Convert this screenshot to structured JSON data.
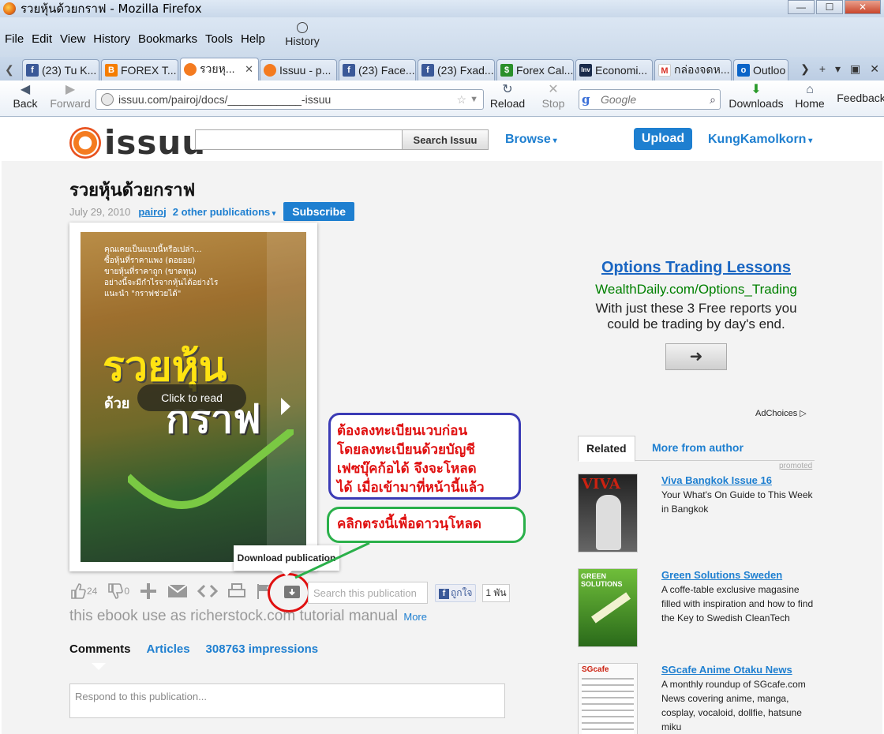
{
  "window": {
    "title": "รวยหุ้นด้วยกราฟ - Mozilla Firefox"
  },
  "menu": {
    "items": [
      "File",
      "Edit",
      "View",
      "History",
      "Bookmarks",
      "Tools",
      "Help"
    ],
    "history_button": "History"
  },
  "tabs": [
    {
      "label": "(23) Tu K...",
      "icon": "facebook-icon",
      "color": "#3b5998"
    },
    {
      "label": "FOREX T...",
      "icon": "blogger-icon",
      "color": "#f57d00"
    },
    {
      "label": "รวยหุ...",
      "icon": "issuu-icon",
      "color": "#f47b20",
      "active": true
    },
    {
      "label": "Issuu - p...",
      "icon": "issuu-icon",
      "color": "#f47b20"
    },
    {
      "label": "(23) Face...",
      "icon": "facebook-icon",
      "color": "#3b5998"
    },
    {
      "label": "(23) Fxad...",
      "icon": "facebook-icon",
      "color": "#3b5998"
    },
    {
      "label": "Forex Cal...",
      "icon": "forex-icon",
      "color": "#2a8f2a"
    },
    {
      "label": "Economi...",
      "icon": "investing-icon",
      "color": "#1a2b4a"
    },
    {
      "label": "กล่องจดห...",
      "icon": "gmail-icon",
      "color": "#d93025"
    },
    {
      "label": "Outloo",
      "icon": "outlook-icon",
      "color": "#0a64c8"
    }
  ],
  "nav": {
    "back": "Back",
    "forward": "Forward",
    "url": "issuu.com/pairoj/docs/____________-issuu",
    "reload": "Reload",
    "stop": "Stop",
    "search_placeholder": "Google",
    "downloads": "Downloads",
    "home": "Home",
    "feedback": "Feedback"
  },
  "site": {
    "logo": "issuu",
    "search_button": "Search Issuu",
    "browse": "Browse",
    "upload": "Upload",
    "user": "KungKamolkorn"
  },
  "doc": {
    "title": "รวยหุ้นด้วยกราฟ",
    "date": "July 29, 2010",
    "author": "pairoj",
    "other_pubs": "2 other publications",
    "subscribe": "Subscribe",
    "click_to_read": "Click to read",
    "cover": {
      "blurb": [
        "คุณเคยเป็นแบบนี้หรือเปล่า...",
        "ซื้อหุ้นที่ราคาแพง (ดอยอย)",
        "ขายหุ้นที่ราคาถูก (ขาดทุน)",
        "อย่างนี้จะมีกำไรจากหุ้นได้อย่างไร",
        "แนะนำ \"กราฟช่วยได้\""
      ],
      "title_top": "รวยหุ้น",
      "title_small": "ด้วย",
      "title_bottom": "กราฟ"
    },
    "likes": "24",
    "dislikes": "0",
    "tooltip": "Download publication",
    "pub_search_placeholder": "Search this publication",
    "fb_like": "ถูกใจ",
    "fb_count": "1 พัน",
    "description": "this ebook use as richerstock.com tutorial manual",
    "more": "More",
    "tabs": [
      "Comments",
      "Articles",
      "308763 impressions"
    ],
    "respond_placeholder": "Respond to this publication..."
  },
  "annotations": {
    "blue_note": [
      "ต้องลงทะเบียนเวบก่อน",
      "โดยลงทะเบียนด้วยบัญชี",
      "เฟซบุ๊คก้อได้ จึงจะโหลด",
      "ได้ เมื่อเข้ามาที่หน้านี้แล้ว"
    ],
    "green_note": "คลิกตรงนี้เพื่อดาวนฺโหลด"
  },
  "ad": {
    "headline": "Options Trading Lessons",
    "url": "WealthDaily.com/Options_Trading",
    "body": "With just these 3 Free reports you could be trading by day's end.",
    "button": "➜",
    "adchoices": "AdChoices"
  },
  "related": {
    "tabs": [
      "Related",
      "More from author"
    ],
    "promoted": "promoted",
    "items": [
      {
        "title": "Viva Bangkok Issue 16",
        "desc": "Your What's On Guide to This Week in Bangkok"
      },
      {
        "title": "Green Solutions Sweden",
        "desc": "A coffe-table exclusive magasine filled with inspiration and how to find the Key to Swedish CleanTech"
      },
      {
        "title": "SGcafe Anime Otaku News",
        "desc": "A monthly roundup of SGcafe.com News covering anime, manga, cosplay, vocaloid, dollfie, hatsune miku"
      }
    ],
    "thumb_texts": [
      "VIVA",
      "GREEN SOLUTIONS",
      "SGcafe"
    ]
  }
}
